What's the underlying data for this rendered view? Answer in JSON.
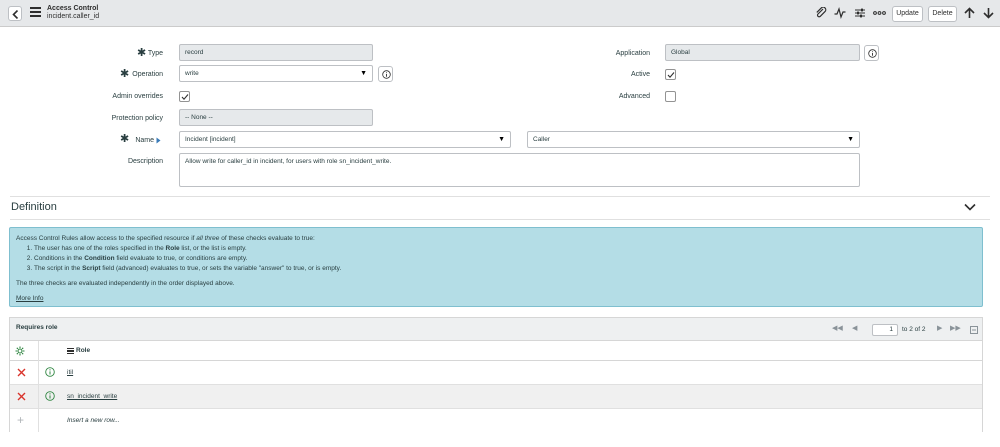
{
  "header": {
    "title": "Access Control",
    "subtitle": "incident.caller_id",
    "update_label": "Update",
    "delete_label": "Delete"
  },
  "form": {
    "type": {
      "label": "Type",
      "value": "record"
    },
    "operation": {
      "label": "Operation",
      "value": "write"
    },
    "admin_overrides": {
      "label": "Admin overrides",
      "checked": true
    },
    "protection_policy": {
      "label": "Protection policy",
      "value": "-- None --"
    },
    "name": {
      "label": "Name",
      "table": "Incident [incident]",
      "field": "Caller"
    },
    "description": {
      "label": "Description",
      "value": "Allow write for caller_id in incident, for users with role sn_incident_write."
    },
    "application": {
      "label": "Application",
      "value": "Global"
    },
    "active": {
      "label": "Active",
      "checked": true
    },
    "advanced": {
      "label": "Advanced",
      "checked": false
    }
  },
  "definition": {
    "title": "Definition",
    "intro_pre": "Access Control Rules allow access to the specified resource if ",
    "intro_em": "all three",
    "intro_post": " of these checks evaluate to true:",
    "items": [
      {
        "pre": "The user has one of the roles specified in the ",
        "bold": "Role",
        "post": " list, or the list is empty."
      },
      {
        "pre": "Conditions in the ",
        "bold": "Condition",
        "post": " field evaluate to true, or conditions are empty."
      },
      {
        "pre": "The script in the ",
        "bold": "Script",
        "post": " field (advanced) evaluates to true, or sets the variable \"answer\" to true, or is empty."
      }
    ],
    "note": "The three checks are evaluated independently in the order displayed above.",
    "more_info": "More Info"
  },
  "related_list": {
    "title": "Requires role",
    "page_value": "1",
    "page_of": "to 2 of 2",
    "column_label": "Role",
    "rows": [
      {
        "role": "itil"
      },
      {
        "role": "sn_incident_write"
      }
    ],
    "insert_label": "Insert a new row..."
  },
  "colors": {
    "header_bg": "#e6e8ea",
    "info_bg": "#b4dde6",
    "delete_x": "#d9332b",
    "info_icon": "#2e8540"
  },
  "icons": [
    "back-icon",
    "menu-icon",
    "attachment-icon",
    "activity-icon",
    "settings-sliders-icon",
    "more-icon",
    "arrow-up-icon",
    "arrow-down-icon",
    "info-icon",
    "checkmark-icon",
    "chevron-down-icon",
    "gear-icon",
    "delete-icon",
    "plus-icon"
  ]
}
